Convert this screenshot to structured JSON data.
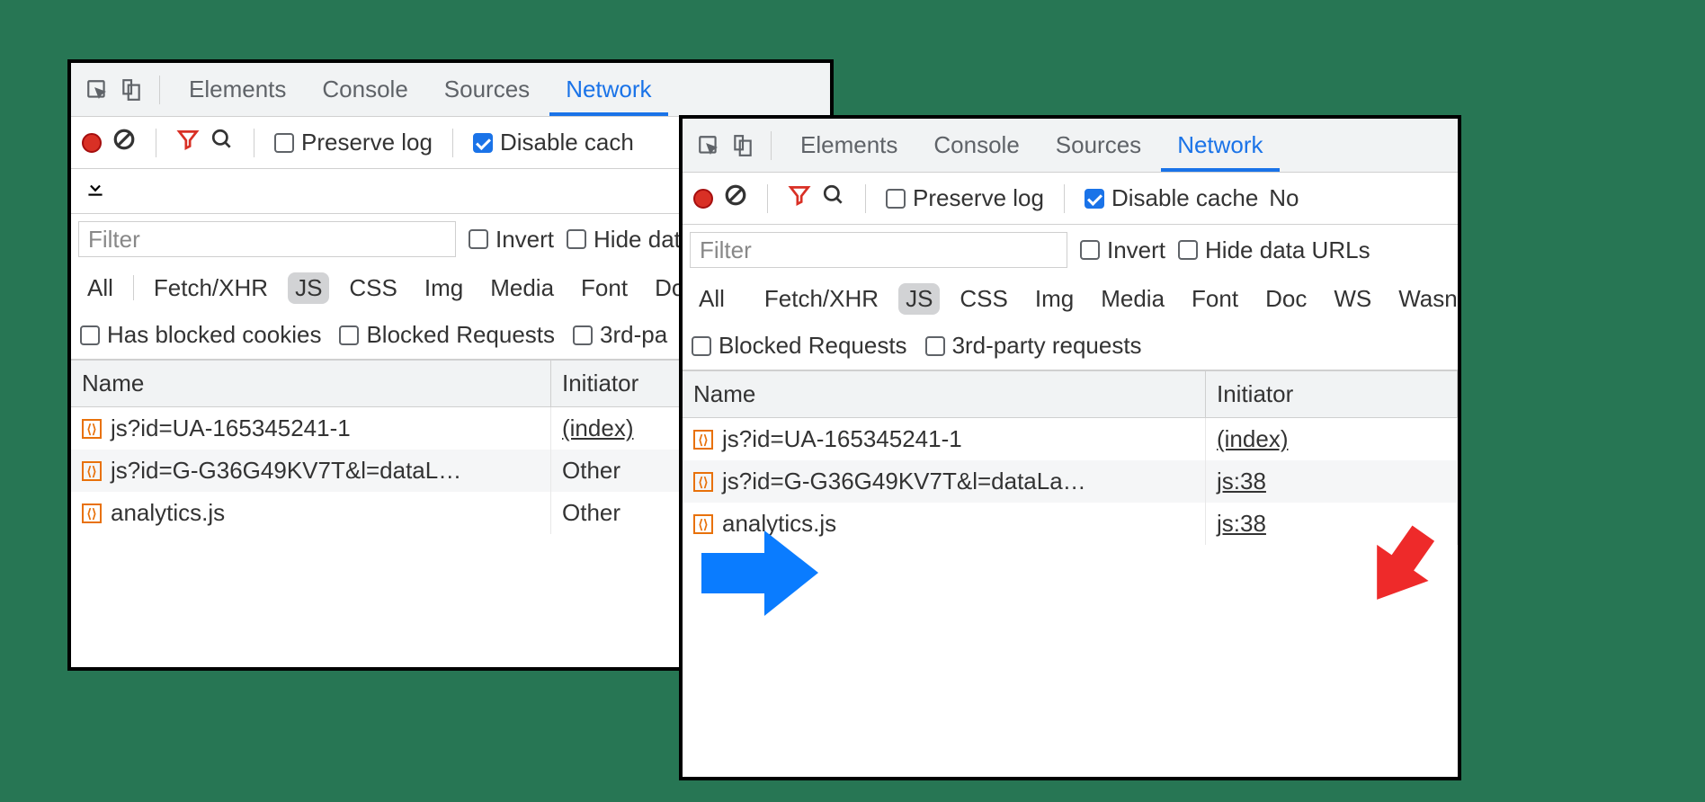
{
  "tabs": {
    "elements": "Elements",
    "console": "Console",
    "sources": "Sources",
    "network": "Network"
  },
  "toolbar": {
    "preserve_log": "Preserve log",
    "disable_cache_partial": "Disable cach",
    "disable_cache_full": "Disable cache",
    "no_partial": "No"
  },
  "filter": {
    "placeholder": "Filter",
    "invert": "Invert",
    "hide_urls_partial": "Hide data UR",
    "hide_urls_full": "Hide data URLs"
  },
  "types": {
    "all": "All",
    "fetch": "Fetch/XHR",
    "js": "JS",
    "css": "CSS",
    "img": "Img",
    "media": "Media",
    "font": "Font",
    "doc": "Doc",
    "ws": "WS",
    "wasm": "Wasn"
  },
  "checks": {
    "blocked_cookies": "Has blocked cookies",
    "blocked_requests": "Blocked Requests",
    "third_party_partial": "3rd-pa",
    "third_party_full": "3rd-party requests"
  },
  "columns": {
    "name": "Name",
    "initiator": "Initiator"
  },
  "left_rows": [
    {
      "name": "js?id=UA-165345241-1",
      "initiator": "(index)",
      "link": true
    },
    {
      "name": "js?id=G-G36G49KV7T&l=dataL…",
      "initiator": "Other",
      "link": false
    },
    {
      "name": "analytics.js",
      "initiator": "Other",
      "link": false
    }
  ],
  "right_rows": [
    {
      "name": "js?id=UA-165345241-1",
      "initiator": "(index)"
    },
    {
      "name": "js?id=G-G36G49KV7T&l=dataLa…",
      "initiator": "js:38"
    },
    {
      "name": "analytics.js",
      "initiator": "js:38"
    }
  ]
}
